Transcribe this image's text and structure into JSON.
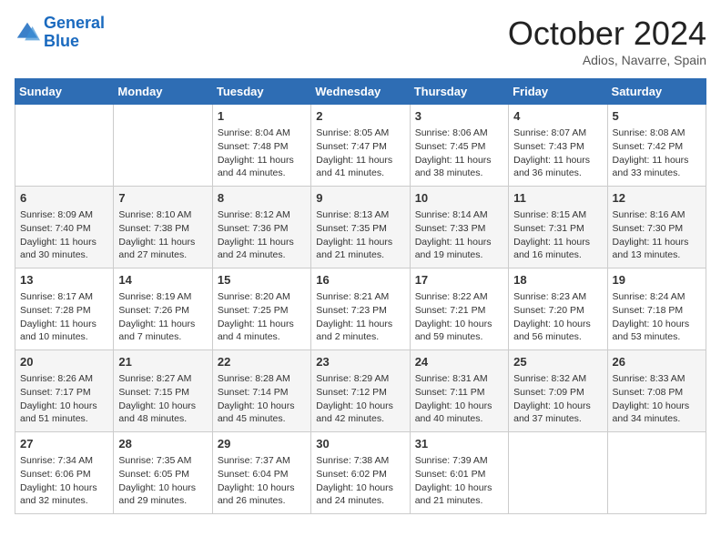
{
  "logo": {
    "line1": "General",
    "line2": "Blue"
  },
  "title": "October 2024",
  "location": "Adios, Navarre, Spain",
  "days_of_week": [
    "Sunday",
    "Monday",
    "Tuesday",
    "Wednesday",
    "Thursday",
    "Friday",
    "Saturday"
  ],
  "weeks": [
    [
      {
        "day": "",
        "sunrise": "",
        "sunset": "",
        "daylight": ""
      },
      {
        "day": "",
        "sunrise": "",
        "sunset": "",
        "daylight": ""
      },
      {
        "day": "1",
        "sunrise": "Sunrise: 8:04 AM",
        "sunset": "Sunset: 7:48 PM",
        "daylight": "Daylight: 11 hours and 44 minutes."
      },
      {
        "day": "2",
        "sunrise": "Sunrise: 8:05 AM",
        "sunset": "Sunset: 7:47 PM",
        "daylight": "Daylight: 11 hours and 41 minutes."
      },
      {
        "day": "3",
        "sunrise": "Sunrise: 8:06 AM",
        "sunset": "Sunset: 7:45 PM",
        "daylight": "Daylight: 11 hours and 38 minutes."
      },
      {
        "day": "4",
        "sunrise": "Sunrise: 8:07 AM",
        "sunset": "Sunset: 7:43 PM",
        "daylight": "Daylight: 11 hours and 36 minutes."
      },
      {
        "day": "5",
        "sunrise": "Sunrise: 8:08 AM",
        "sunset": "Sunset: 7:42 PM",
        "daylight": "Daylight: 11 hours and 33 minutes."
      }
    ],
    [
      {
        "day": "6",
        "sunrise": "Sunrise: 8:09 AM",
        "sunset": "Sunset: 7:40 PM",
        "daylight": "Daylight: 11 hours and 30 minutes."
      },
      {
        "day": "7",
        "sunrise": "Sunrise: 8:10 AM",
        "sunset": "Sunset: 7:38 PM",
        "daylight": "Daylight: 11 hours and 27 minutes."
      },
      {
        "day": "8",
        "sunrise": "Sunrise: 8:12 AM",
        "sunset": "Sunset: 7:36 PM",
        "daylight": "Daylight: 11 hours and 24 minutes."
      },
      {
        "day": "9",
        "sunrise": "Sunrise: 8:13 AM",
        "sunset": "Sunset: 7:35 PM",
        "daylight": "Daylight: 11 hours and 21 minutes."
      },
      {
        "day": "10",
        "sunrise": "Sunrise: 8:14 AM",
        "sunset": "Sunset: 7:33 PM",
        "daylight": "Daylight: 11 hours and 19 minutes."
      },
      {
        "day": "11",
        "sunrise": "Sunrise: 8:15 AM",
        "sunset": "Sunset: 7:31 PM",
        "daylight": "Daylight: 11 hours and 16 minutes."
      },
      {
        "day": "12",
        "sunrise": "Sunrise: 8:16 AM",
        "sunset": "Sunset: 7:30 PM",
        "daylight": "Daylight: 11 hours and 13 minutes."
      }
    ],
    [
      {
        "day": "13",
        "sunrise": "Sunrise: 8:17 AM",
        "sunset": "Sunset: 7:28 PM",
        "daylight": "Daylight: 11 hours and 10 minutes."
      },
      {
        "day": "14",
        "sunrise": "Sunrise: 8:19 AM",
        "sunset": "Sunset: 7:26 PM",
        "daylight": "Daylight: 11 hours and 7 minutes."
      },
      {
        "day": "15",
        "sunrise": "Sunrise: 8:20 AM",
        "sunset": "Sunset: 7:25 PM",
        "daylight": "Daylight: 11 hours and 4 minutes."
      },
      {
        "day": "16",
        "sunrise": "Sunrise: 8:21 AM",
        "sunset": "Sunset: 7:23 PM",
        "daylight": "Daylight: 11 hours and 2 minutes."
      },
      {
        "day": "17",
        "sunrise": "Sunrise: 8:22 AM",
        "sunset": "Sunset: 7:21 PM",
        "daylight": "Daylight: 10 hours and 59 minutes."
      },
      {
        "day": "18",
        "sunrise": "Sunrise: 8:23 AM",
        "sunset": "Sunset: 7:20 PM",
        "daylight": "Daylight: 10 hours and 56 minutes."
      },
      {
        "day": "19",
        "sunrise": "Sunrise: 8:24 AM",
        "sunset": "Sunset: 7:18 PM",
        "daylight": "Daylight: 10 hours and 53 minutes."
      }
    ],
    [
      {
        "day": "20",
        "sunrise": "Sunrise: 8:26 AM",
        "sunset": "Sunset: 7:17 PM",
        "daylight": "Daylight: 10 hours and 51 minutes."
      },
      {
        "day": "21",
        "sunrise": "Sunrise: 8:27 AM",
        "sunset": "Sunset: 7:15 PM",
        "daylight": "Daylight: 10 hours and 48 minutes."
      },
      {
        "day": "22",
        "sunrise": "Sunrise: 8:28 AM",
        "sunset": "Sunset: 7:14 PM",
        "daylight": "Daylight: 10 hours and 45 minutes."
      },
      {
        "day": "23",
        "sunrise": "Sunrise: 8:29 AM",
        "sunset": "Sunset: 7:12 PM",
        "daylight": "Daylight: 10 hours and 42 minutes."
      },
      {
        "day": "24",
        "sunrise": "Sunrise: 8:31 AM",
        "sunset": "Sunset: 7:11 PM",
        "daylight": "Daylight: 10 hours and 40 minutes."
      },
      {
        "day": "25",
        "sunrise": "Sunrise: 8:32 AM",
        "sunset": "Sunset: 7:09 PM",
        "daylight": "Daylight: 10 hours and 37 minutes."
      },
      {
        "day": "26",
        "sunrise": "Sunrise: 8:33 AM",
        "sunset": "Sunset: 7:08 PM",
        "daylight": "Daylight: 10 hours and 34 minutes."
      }
    ],
    [
      {
        "day": "27",
        "sunrise": "Sunrise: 7:34 AM",
        "sunset": "Sunset: 6:06 PM",
        "daylight": "Daylight: 10 hours and 32 minutes."
      },
      {
        "day": "28",
        "sunrise": "Sunrise: 7:35 AM",
        "sunset": "Sunset: 6:05 PM",
        "daylight": "Daylight: 10 hours and 29 minutes."
      },
      {
        "day": "29",
        "sunrise": "Sunrise: 7:37 AM",
        "sunset": "Sunset: 6:04 PM",
        "daylight": "Daylight: 10 hours and 26 minutes."
      },
      {
        "day": "30",
        "sunrise": "Sunrise: 7:38 AM",
        "sunset": "Sunset: 6:02 PM",
        "daylight": "Daylight: 10 hours and 24 minutes."
      },
      {
        "day": "31",
        "sunrise": "Sunrise: 7:39 AM",
        "sunset": "Sunset: 6:01 PM",
        "daylight": "Daylight: 10 hours and 21 minutes."
      },
      {
        "day": "",
        "sunrise": "",
        "sunset": "",
        "daylight": ""
      },
      {
        "day": "",
        "sunrise": "",
        "sunset": "",
        "daylight": ""
      }
    ]
  ]
}
